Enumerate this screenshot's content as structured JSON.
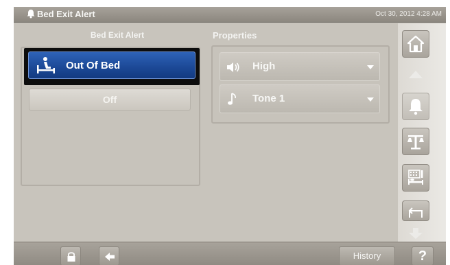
{
  "titlebar": {
    "title": "Bed Exit Alert",
    "datetime": "Oct 30, 2012 4:28 AM"
  },
  "left_panel": {
    "header": "Bed Exit Alert",
    "options": [
      {
        "label": "Out Of Bed",
        "selected": true,
        "icon": "bed-exit-icon"
      },
      {
        "label": "Off",
        "selected": false
      }
    ]
  },
  "properties": {
    "header": "Properties",
    "volume": {
      "value": "High",
      "icon": "speaker-icon"
    },
    "tone": {
      "value": "Tone 1",
      "icon": "music-note-icon"
    }
  },
  "rail": {
    "items": [
      {
        "name": "home",
        "icon": "home-icon"
      },
      {
        "name": "alarm",
        "icon": "bell-icon",
        "disabled": true
      },
      {
        "name": "scale",
        "icon": "scale-icon"
      },
      {
        "name": "chart",
        "icon": "bed-chart-icon"
      },
      {
        "name": "more",
        "icon": "folder-return-icon"
      }
    ]
  },
  "bottombar": {
    "history_label": "History",
    "help_label": "?"
  },
  "colors": {
    "selected_blue": "#1d4a98",
    "panel": "#c7c3bb",
    "bar": "#8f8a82"
  }
}
